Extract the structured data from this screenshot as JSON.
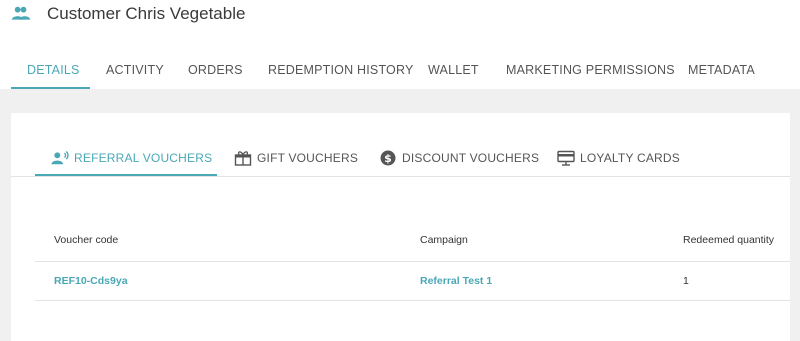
{
  "header": {
    "title": "Customer Chris Vegetable",
    "icon": "people-icon"
  },
  "colors": {
    "accent": "#4aa8b6",
    "band": "#f0f0f0"
  },
  "main_tabs": [
    {
      "label": "DETAILS",
      "active": true
    },
    {
      "label": "ACTIVITY",
      "active": false
    },
    {
      "label": "ORDERS",
      "active": false
    },
    {
      "label": "REDEMPTION HISTORY",
      "active": false
    },
    {
      "label": "WALLET",
      "active": false
    },
    {
      "label": "MARKETING PERMISSIONS",
      "active": false
    },
    {
      "label": "METADATA",
      "active": false
    }
  ],
  "voucher_tabs": [
    {
      "label": "REFERRAL VOUCHERS",
      "icon": "referral-icon",
      "active": true
    },
    {
      "label": "GIFT VOUCHERS",
      "icon": "gift-icon",
      "active": false
    },
    {
      "label": "DISCOUNT VOUCHERS",
      "icon": "dollar-coin-icon",
      "active": false
    },
    {
      "label": "LOYALTY CARDS",
      "icon": "loyalty-card-icon",
      "active": false
    }
  ],
  "table": {
    "columns": [
      "Voucher code",
      "Campaign",
      "Redeemed quantity"
    ],
    "rows": [
      {
        "voucher_code": "REF10-Cds9ya",
        "campaign": "Referral Test 1",
        "redeemed_quantity": "1"
      }
    ]
  }
}
